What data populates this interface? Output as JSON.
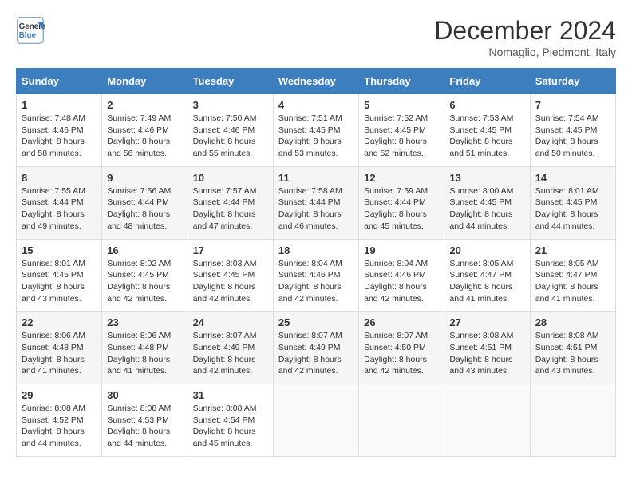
{
  "header": {
    "logo_line1": "General",
    "logo_line2": "Blue",
    "month_year": "December 2024",
    "location": "Nomaglio, Piedmont, Italy"
  },
  "weekdays": [
    "Sunday",
    "Monday",
    "Tuesday",
    "Wednesday",
    "Thursday",
    "Friday",
    "Saturday"
  ],
  "weeks": [
    [
      {
        "day": "1",
        "sunrise": "7:48 AM",
        "sunset": "4:46 PM",
        "daylight": "8 hours and 58 minutes."
      },
      {
        "day": "2",
        "sunrise": "7:49 AM",
        "sunset": "4:46 PM",
        "daylight": "8 hours and 56 minutes."
      },
      {
        "day": "3",
        "sunrise": "7:50 AM",
        "sunset": "4:46 PM",
        "daylight": "8 hours and 55 minutes."
      },
      {
        "day": "4",
        "sunrise": "7:51 AM",
        "sunset": "4:45 PM",
        "daylight": "8 hours and 53 minutes."
      },
      {
        "day": "5",
        "sunrise": "7:52 AM",
        "sunset": "4:45 PM",
        "daylight": "8 hours and 52 minutes."
      },
      {
        "day": "6",
        "sunrise": "7:53 AM",
        "sunset": "4:45 PM",
        "daylight": "8 hours and 51 minutes."
      },
      {
        "day": "7",
        "sunrise": "7:54 AM",
        "sunset": "4:45 PM",
        "daylight": "8 hours and 50 minutes."
      }
    ],
    [
      {
        "day": "8",
        "sunrise": "7:55 AM",
        "sunset": "4:44 PM",
        "daylight": "8 hours and 49 minutes."
      },
      {
        "day": "9",
        "sunrise": "7:56 AM",
        "sunset": "4:44 PM",
        "daylight": "8 hours and 48 minutes."
      },
      {
        "day": "10",
        "sunrise": "7:57 AM",
        "sunset": "4:44 PM",
        "daylight": "8 hours and 47 minutes."
      },
      {
        "day": "11",
        "sunrise": "7:58 AM",
        "sunset": "4:44 PM",
        "daylight": "8 hours and 46 minutes."
      },
      {
        "day": "12",
        "sunrise": "7:59 AM",
        "sunset": "4:44 PM",
        "daylight": "8 hours and 45 minutes."
      },
      {
        "day": "13",
        "sunrise": "8:00 AM",
        "sunset": "4:45 PM",
        "daylight": "8 hours and 44 minutes."
      },
      {
        "day": "14",
        "sunrise": "8:01 AM",
        "sunset": "4:45 PM",
        "daylight": "8 hours and 44 minutes."
      }
    ],
    [
      {
        "day": "15",
        "sunrise": "8:01 AM",
        "sunset": "4:45 PM",
        "daylight": "8 hours and 43 minutes."
      },
      {
        "day": "16",
        "sunrise": "8:02 AM",
        "sunset": "4:45 PM",
        "daylight": "8 hours and 42 minutes."
      },
      {
        "day": "17",
        "sunrise": "8:03 AM",
        "sunset": "4:45 PM",
        "daylight": "8 hours and 42 minutes."
      },
      {
        "day": "18",
        "sunrise": "8:04 AM",
        "sunset": "4:46 PM",
        "daylight": "8 hours and 42 minutes."
      },
      {
        "day": "19",
        "sunrise": "8:04 AM",
        "sunset": "4:46 PM",
        "daylight": "8 hours and 42 minutes."
      },
      {
        "day": "20",
        "sunrise": "8:05 AM",
        "sunset": "4:47 PM",
        "daylight": "8 hours and 41 minutes."
      },
      {
        "day": "21",
        "sunrise": "8:05 AM",
        "sunset": "4:47 PM",
        "daylight": "8 hours and 41 minutes."
      }
    ],
    [
      {
        "day": "22",
        "sunrise": "8:06 AM",
        "sunset": "4:48 PM",
        "daylight": "8 hours and 41 minutes."
      },
      {
        "day": "23",
        "sunrise": "8:06 AM",
        "sunset": "4:48 PM",
        "daylight": "8 hours and 41 minutes."
      },
      {
        "day": "24",
        "sunrise": "8:07 AM",
        "sunset": "4:49 PM",
        "daylight": "8 hours and 42 minutes."
      },
      {
        "day": "25",
        "sunrise": "8:07 AM",
        "sunset": "4:49 PM",
        "daylight": "8 hours and 42 minutes."
      },
      {
        "day": "26",
        "sunrise": "8:07 AM",
        "sunset": "4:50 PM",
        "daylight": "8 hours and 42 minutes."
      },
      {
        "day": "27",
        "sunrise": "8:08 AM",
        "sunset": "4:51 PM",
        "daylight": "8 hours and 43 minutes."
      },
      {
        "day": "28",
        "sunrise": "8:08 AM",
        "sunset": "4:51 PM",
        "daylight": "8 hours and 43 minutes."
      }
    ],
    [
      {
        "day": "29",
        "sunrise": "8:08 AM",
        "sunset": "4:52 PM",
        "daylight": "8 hours and 44 minutes."
      },
      {
        "day": "30",
        "sunrise": "8:08 AM",
        "sunset": "4:53 PM",
        "daylight": "8 hours and 44 minutes."
      },
      {
        "day": "31",
        "sunrise": "8:08 AM",
        "sunset": "4:54 PM",
        "daylight": "8 hours and 45 minutes."
      },
      null,
      null,
      null,
      null
    ]
  ],
  "labels": {
    "sunrise": "Sunrise:",
    "sunset": "Sunset:",
    "daylight": "Daylight:"
  }
}
